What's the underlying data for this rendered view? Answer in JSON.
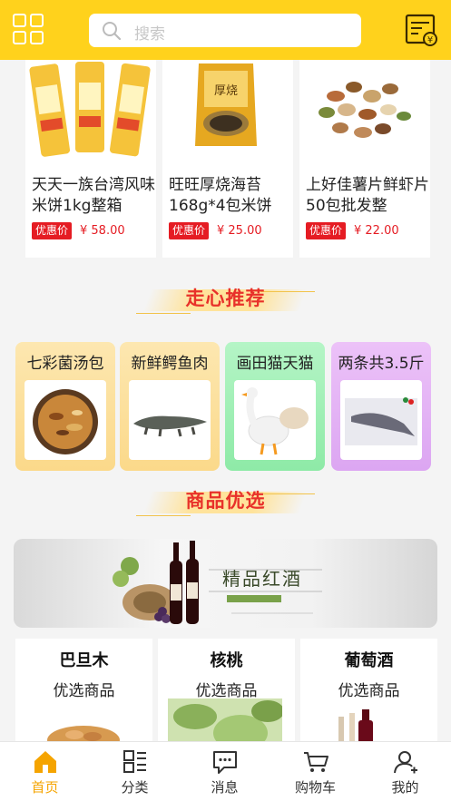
{
  "search": {
    "placeholder": "搜索"
  },
  "products": [
    {
      "name": "天天一族台湾风味米饼1kg整箱",
      "tag": "优惠价",
      "price": "¥ 58.00"
    },
    {
      "name": "旺旺厚烧海苔168g*4包米饼",
      "tag": "优惠价",
      "price": "¥ 25.00"
    },
    {
      "name": "上好佳薯片鲜虾片50包批发整",
      "tag": "优惠价",
      "price": "¥ 22.00"
    }
  ],
  "sections": {
    "recommend_title": "走心推荐",
    "selected_title": "商品优选"
  },
  "recommend": [
    {
      "title": "七彩菌汤包",
      "color": "#fde2a6"
    },
    {
      "title": "新鲜鳄鱼肉",
      "color": "#fde2a6"
    },
    {
      "title": "画田猫天猫",
      "color": "#a8f2bc"
    },
    {
      "title": "两条共3.5斤",
      "color": "#e8b6f5"
    }
  ],
  "banner": {
    "title": "精品红酒"
  },
  "categories": [
    {
      "title": "巴旦木",
      "subtitle": "优选商品"
    },
    {
      "title": "核桃",
      "subtitle": "优选商品"
    },
    {
      "title": "葡萄酒",
      "subtitle": "优选商品"
    }
  ],
  "tabbar": [
    {
      "label": "首页",
      "icon": "home-icon",
      "active": true
    },
    {
      "label": "分类",
      "icon": "category-icon",
      "active": false
    },
    {
      "label": "消息",
      "icon": "message-icon",
      "active": false
    },
    {
      "label": "购物车",
      "icon": "cart-icon",
      "active": false
    },
    {
      "label": "我的",
      "icon": "user-icon",
      "active": false
    }
  ],
  "colors": {
    "brand": "#ffd21c",
    "accent": "#e51c23",
    "active_tab": "#f5a400"
  }
}
